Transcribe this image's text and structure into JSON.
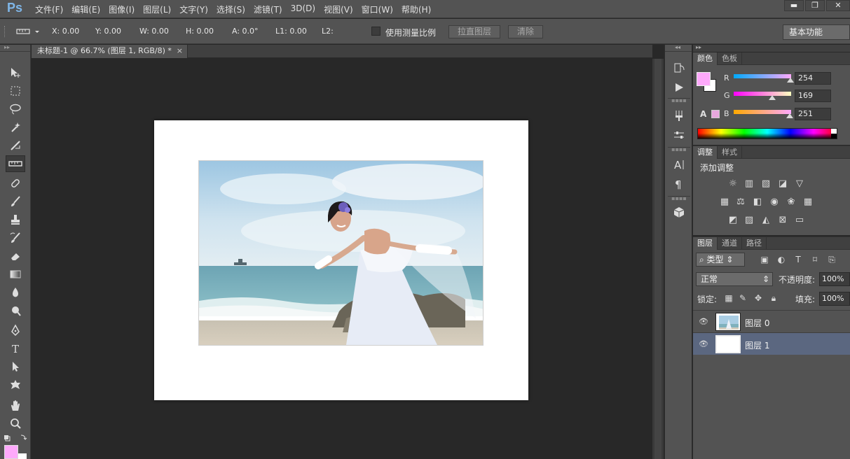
{
  "app": {
    "logo": "Ps",
    "menu": [
      "文件(F)",
      "编辑(E)",
      "图像(I)",
      "图层(L)",
      "文字(Y)",
      "选择(S)",
      "滤镜(T)",
      "3D(D)",
      "视图(V)",
      "窗口(W)",
      "帮助(H)"
    ],
    "window_buttons": [
      "▬",
      "❐",
      "✕"
    ]
  },
  "options": {
    "x": "X: 0.00",
    "y": "Y: 0.00",
    "w": "W: 0.00",
    "h": "H: 0.00",
    "a": "A: 0.0°",
    "l1": "L1: 0.00",
    "l2": "L2:",
    "use_measure_scale": "使用测量比例",
    "straighten_button": "拉直图层",
    "clear_button": "清除",
    "workspace": "基本功能"
  },
  "document": {
    "tab_title": "未标题-1 @ 66.7% (图层 1, RGB/8) *",
    "tab_close": "×"
  },
  "colors": {
    "foreground": "#fea9fb",
    "background": "#ffffff",
    "selected_layer": "#5b6780"
  },
  "color_panel": {
    "tabs": [
      "颜色",
      "色板"
    ],
    "channels": [
      {
        "label": "R",
        "value": "254"
      },
      {
        "label": "G",
        "value": "169"
      },
      {
        "label": "B",
        "value": "251"
      }
    ]
  },
  "adjust_panel": {
    "tabs": [
      "调整",
      "样式"
    ],
    "title": "添加调整"
  },
  "layers_panel": {
    "tabs": [
      "图层",
      "通道",
      "路径"
    ],
    "filter_kind": "类型",
    "blend_mode": "正常",
    "opacity_label": "不透明度:",
    "opacity_value": "100%",
    "lock_label": "锁定:",
    "fill_label": "填充:",
    "fill_value": "100%",
    "layers": [
      {
        "name": "图层 0",
        "selected": false
      },
      {
        "name": "图层 1",
        "selected": true
      }
    ]
  }
}
